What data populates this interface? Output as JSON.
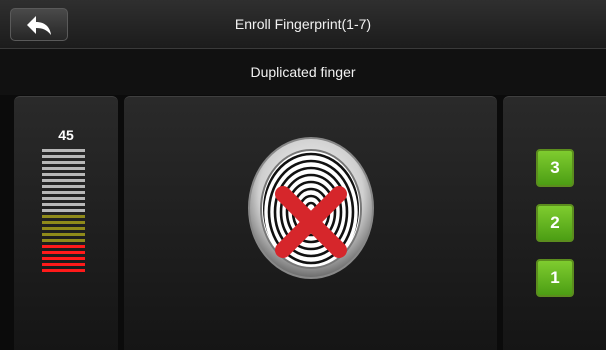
{
  "header": {
    "back_icon": "back-arrow-icon",
    "title": "Enroll Fingerprint(1-7)"
  },
  "status": {
    "message": "Duplicated finger"
  },
  "quality": {
    "value": "45",
    "bars": [
      "#b7b7b7",
      "#b7b7b7",
      "#b7b7b7",
      "#b7b7b7",
      "#b7b7b7",
      "#b7b7b7",
      "#b7b7b7",
      "#b7b7b7",
      "#b7b7b7",
      "#b7b7b7",
      "#b7b7b7",
      "#8f8a1a",
      "#8f8a1a",
      "#8f8a1a",
      "#8f8a1a",
      "#8f8a1a",
      "#ff1a1a",
      "#ff1a1a",
      "#ff1a1a",
      "#ff1a1a",
      "#ff1a1a"
    ]
  },
  "fingerprint": {
    "icon": "fingerprint-icon",
    "state_icon": "x-mark-icon",
    "state_color": "#d6262b"
  },
  "steps": {
    "items": [
      "3",
      "2",
      "1"
    ],
    "color": "#6cbf22"
  }
}
